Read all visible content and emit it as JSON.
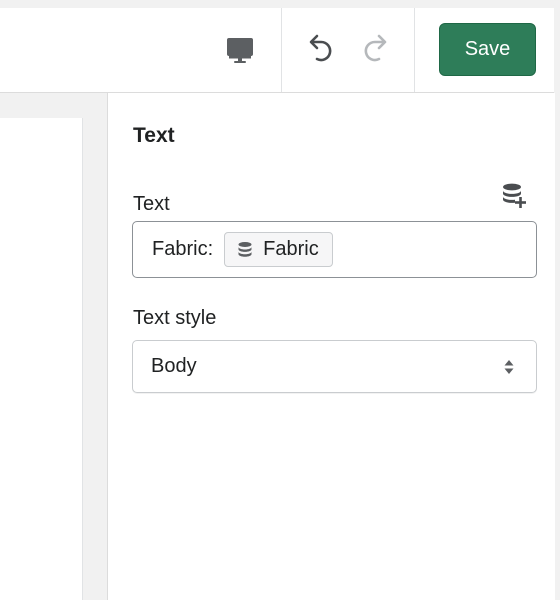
{
  "toolbar": {
    "save_label": "Save",
    "icons": [
      "desktop-icon",
      "undo-icon",
      "redo-icon"
    ]
  },
  "panel": {
    "title": "Text",
    "text_field": {
      "label": "Text",
      "prefix": "Fabric:",
      "token_label": "Fabric",
      "token_icon": "database-icon",
      "action_icon": "database-add-icon"
    },
    "text_style": {
      "label": "Text style",
      "value": "Body"
    }
  },
  "colors": {
    "accent": "#2e7d59",
    "border": "#c9cccf",
    "background": "#f1f1f1"
  }
}
